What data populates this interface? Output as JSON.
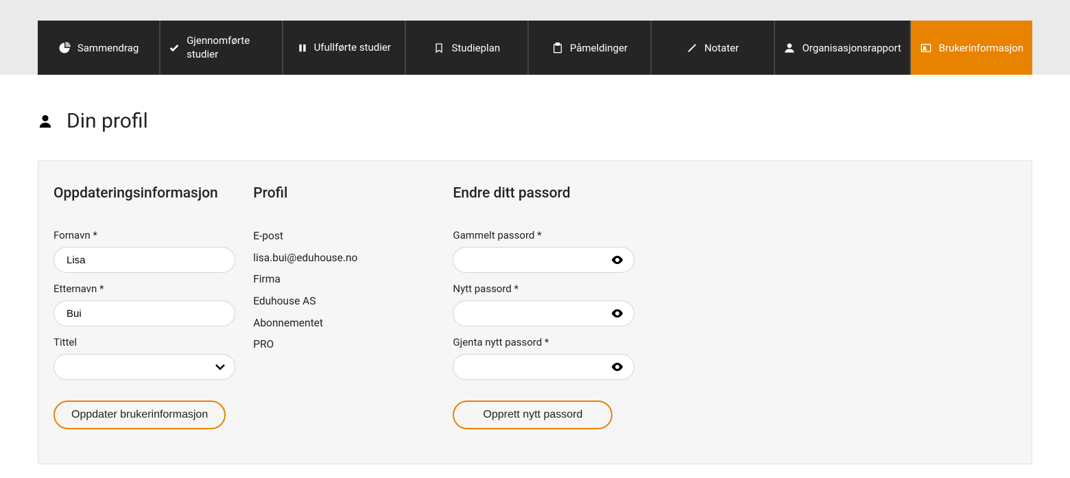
{
  "nav": {
    "items": [
      {
        "label": "Sammendrag"
      },
      {
        "label": "Gjennomførte studier"
      },
      {
        "label": "Ufullførte studier"
      },
      {
        "label": "Studieplan"
      },
      {
        "label": "Påmeldinger"
      },
      {
        "label": "Notater"
      },
      {
        "label": "Organisasjonsrapport"
      },
      {
        "label": "Brukerinformasjon"
      }
    ]
  },
  "page": {
    "title": "Din profil"
  },
  "updateInfo": {
    "heading": "Oppdateringsinformasjon",
    "firstNameLabel": "Fornavn *",
    "firstNameValue": "Lisa",
    "lastNameLabel": "Etternavn *",
    "lastNameValue": "Bui",
    "titleLabel": "Tittel",
    "titleValue": "",
    "updateBtn": "Oppdater brukerinformasjon"
  },
  "profile": {
    "heading": "Profil",
    "emailLabel": "E-post",
    "emailValue": "lisa.bui@eduhouse.no",
    "companyLabel": "Firma",
    "companyValue": "Eduhouse AS",
    "subscriptionLabel": "Abonnementet",
    "subscriptionValue": "PRO"
  },
  "password": {
    "heading": "Endre ditt passord",
    "oldLabel": "Gammelt passord *",
    "newLabel": "Nytt passord *",
    "repeatLabel": "Gjenta nytt passord *",
    "createBtn": "Opprett nytt passord"
  }
}
